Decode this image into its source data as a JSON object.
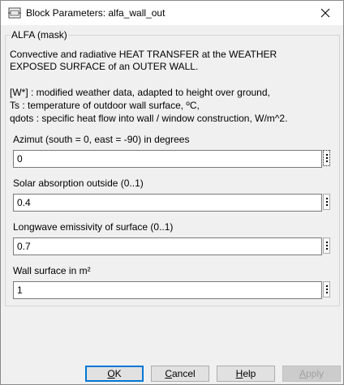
{
  "window": {
    "title": "Block Parameters: alfa_wall_out",
    "colors": {
      "accent": "#0078d7",
      "titlebar": "#ffffff",
      "background": "#f0f0f0"
    }
  },
  "group": {
    "label": "ALFA (mask)"
  },
  "description": {
    "line1": "Convective and radiative HEAT TRANSFER at the WEATHER",
    "line2": "EXPOSED SURFACE of an OUTER WALL.",
    "line3": "[W*] : modified weather data, adapted to height over ground,",
    "line4": "Ts : temperature of outdoor wall surface, ºC,",
    "line5": "qdots : specific heat flow into wall / window construction, W/m^2."
  },
  "params": [
    {
      "label": "Azimut (south = 0, east = -90) in degrees",
      "value": "0"
    },
    {
      "label": "Solar absorption outside (0..1)",
      "value": "0.4"
    },
    {
      "label": "Longwave emissivity of surface (0..1)",
      "value": "0.7"
    },
    {
      "label": "Wall surface in m²",
      "value": "1"
    }
  ],
  "buttons": {
    "ok": {
      "first": "O",
      "rest": "K"
    },
    "cancel": {
      "first": "C",
      "rest": "ancel"
    },
    "help": {
      "first": "H",
      "rest": "elp"
    },
    "apply": {
      "first": "A",
      "rest": "pply"
    }
  },
  "icons": {
    "app": "simulink-block-icon",
    "close": "close-icon",
    "menu": "vertical-ellipsis-icon"
  }
}
